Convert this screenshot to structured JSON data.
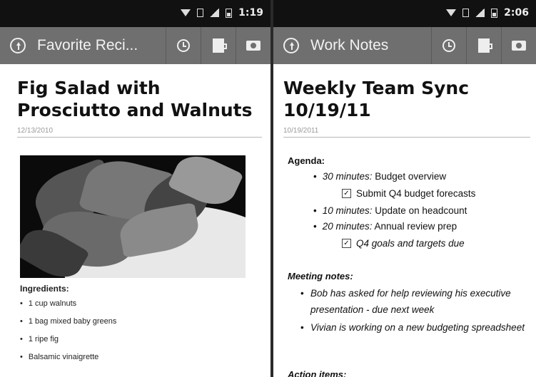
{
  "left_screen": {
    "status": {
      "time": "1:19"
    },
    "actionbar": {
      "title": "Favorite Reci..."
    },
    "note": {
      "title": "Fig Salad with Prosciutto and Walnuts",
      "date": "12/13/2010",
      "ingredients_heading": "Ingredients:",
      "ingredients": [
        "1 cup walnuts",
        "1 bag mixed baby greens",
        "1 ripe fig",
        "Balsamic vinaigrette"
      ]
    }
  },
  "right_screen": {
    "status": {
      "time": "2:06"
    },
    "actionbar": {
      "title": "Work Notes"
    },
    "note": {
      "title": "Weekly Team Sync 10/19/11",
      "date": "10/19/2011",
      "agenda_heading": "Agenda:",
      "agenda": [
        {
          "time": "30 minutes:",
          "text": " Budget overview"
        },
        {
          "time": "10 minutes:",
          "text": " Update on headcount"
        },
        {
          "time": "20 minutes:",
          "text": " Annual review prep"
        }
      ],
      "checkboxes": [
        {
          "label": "Submit Q4 budget forecasts",
          "checked": true
        },
        {
          "label": "Q4 goals and targets due",
          "checked": true
        }
      ],
      "meeting_notes_heading": "Meeting notes:",
      "meeting_notes": [
        "Bob has asked for help reviewing his executive presentation - due next week",
        "Vivian is working on a new budgeting spreadsheet"
      ],
      "action_items_heading": "Action items:"
    }
  },
  "check_mark": "✓",
  "bullet": "•"
}
